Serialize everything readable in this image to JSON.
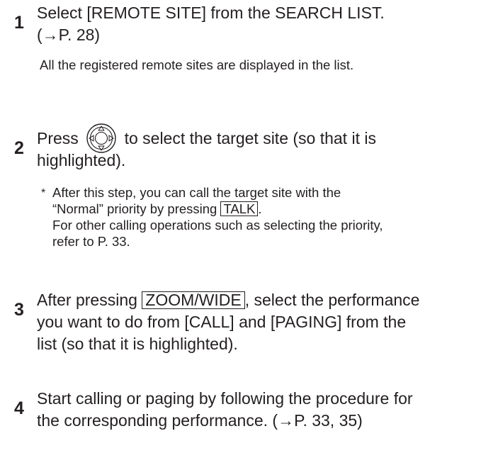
{
  "steps": [
    {
      "number": "1",
      "line1": "Select [REMOTE SITE] from the SEARCH LIST.",
      "line2": "(→P. 28)",
      "note": "All the registered remote sites are displayed in the list."
    },
    {
      "number": "2",
      "text_before_icon": "Press",
      "icon": "dpad-icon",
      "text_after_icon": "to select the target site (so that it is",
      "line2": "highlighted).",
      "note_marker": "*",
      "note_line1": "After this step, you can call the target site with the",
      "note_line2_before_key": "“Normal” priority by pressing",
      "note_key": "TALK",
      "note_line2_after_key": ".",
      "note_line3": "For other calling operations such as selecting the priority,",
      "note_line4": "refer to P. 33."
    },
    {
      "number": "3",
      "text_before_key": "After pressing",
      "key": "ZOOM/WIDE",
      "text_after_key": ", select the performance",
      "line2": "you want to do from [CALL] and [PAGING] from the",
      "line3": "list (so that it is highlighted)."
    },
    {
      "number": "4",
      "line1": "Start calling or paging by following the procedure for",
      "line2": "the corresponding performance. (→P. 33, 35)"
    }
  ]
}
